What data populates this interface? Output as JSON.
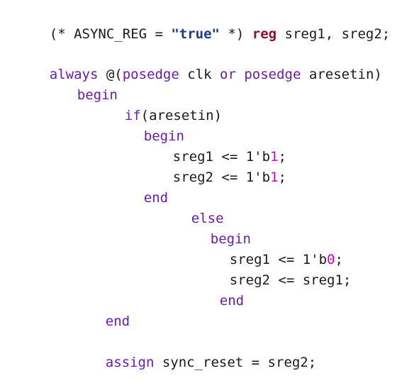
{
  "colors": {
    "keyword": "#6a1cb0",
    "reg_keyword": "#8a1234",
    "string": "#1f3a8a",
    "number_highlight": "#d100c8",
    "text": "#1a1a1a",
    "background": "#ffffff"
  },
  "code": {
    "l1": {
      "a": "(* ASYNC_REG = ",
      "b": "\"true\"",
      "c": " *) ",
      "d": "reg",
      "e": " sreg1, sreg2;"
    },
    "l2": {
      "a": "always",
      "b": " @(",
      "c": "posedge",
      "d": " clk ",
      "e": "or",
      "f": " ",
      "g": "posedge",
      "h": " aresetin)"
    },
    "l3": {
      "a": "begin"
    },
    "l4": {
      "a": "if",
      "b": "(aresetin)"
    },
    "l5": {
      "a": "begin"
    },
    "l6": {
      "a": "sreg1 <= 1'b",
      "b": "1",
      "c": ";"
    },
    "l7": {
      "a": "sreg2 <= 1'b",
      "b": "1",
      "c": ";"
    },
    "l8": {
      "a": "end"
    },
    "l9": {
      "a": "else"
    },
    "l10": {
      "a": "begin"
    },
    "l11": {
      "a": "sreg1 <= 1'b",
      "b": "0",
      "c": ";"
    },
    "l12": {
      "a": "sreg2 <= sreg1;"
    },
    "l13": {
      "a": "end"
    },
    "l14": {
      "a": "end"
    },
    "l15": {
      "a": "assign",
      "b": " sync_reset = sreg2;"
    }
  }
}
